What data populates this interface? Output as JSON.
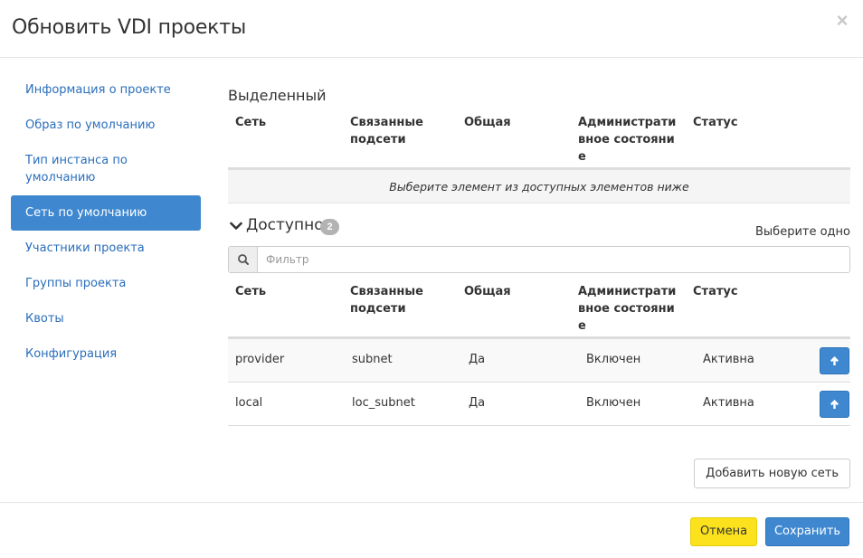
{
  "modal": {
    "title": "Обновить VDI проекты",
    "close_symbol": "×"
  },
  "sidebar": {
    "items": [
      {
        "label": "Информация о проекте",
        "active": false
      },
      {
        "label": "Образ по умолчанию",
        "active": false
      },
      {
        "label": "Тип инстанса по умолчанию",
        "active": false
      },
      {
        "label": "Сеть по умолчанию",
        "active": true
      },
      {
        "label": "Участники проекта",
        "active": false
      },
      {
        "label": "Группы проекта",
        "active": false
      },
      {
        "label": "Квоты",
        "active": false
      },
      {
        "label": "Конфигурация",
        "active": false
      }
    ]
  },
  "allocated": {
    "title": "Выделенный",
    "empty_message": "Выберите элемент из доступных элементов ниже"
  },
  "columns": {
    "network": "Сеть",
    "subnets": "Связанные подсети",
    "shared": "Общая",
    "admin_state": "Административное состояние",
    "status": "Статус"
  },
  "available": {
    "title": "Доступно",
    "count": "2",
    "hint": "Выберите одно",
    "filter_placeholder": "Фильтр",
    "rows": [
      {
        "network": "provider",
        "subnets": "subnet",
        "shared": "Да",
        "admin_state": "Включен",
        "status": "Активна"
      },
      {
        "network": "local",
        "subnets": "loc_subnet",
        "shared": "Да",
        "admin_state": "Включен",
        "status": "Активна"
      }
    ]
  },
  "add_network_label": "Добавить новую сеть",
  "footer": {
    "cancel_label": "Отмена",
    "save_label": "Сохранить"
  },
  "icons": {
    "close": "close-icon",
    "chevron": "chevron-down-icon",
    "search": "search-icon",
    "arrow_up": "arrow-up-icon"
  },
  "colors": {
    "primary": "#3f88cf",
    "link": "#2a6ebb",
    "cancel": "#fce21c",
    "badge": "#b3b3b3"
  }
}
